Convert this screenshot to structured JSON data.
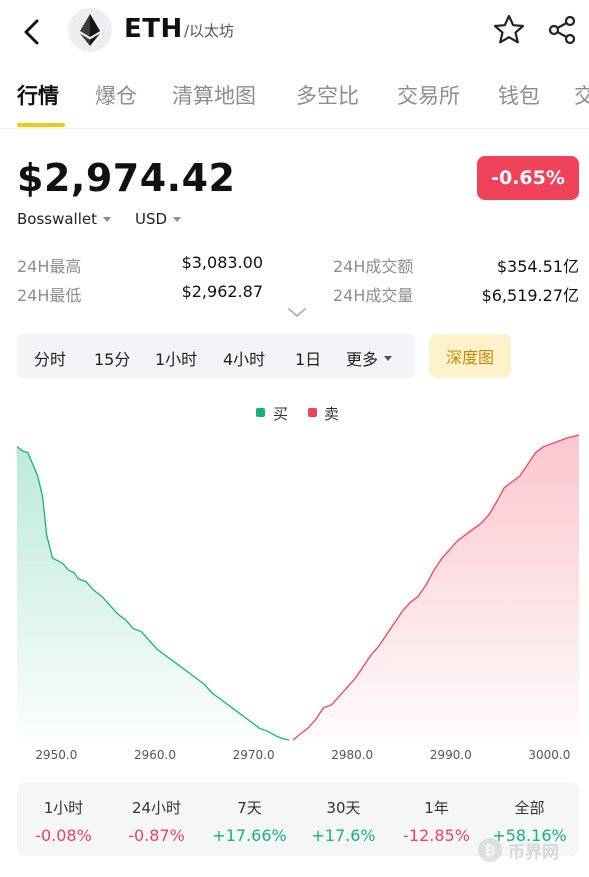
{
  "header": {
    "symbol": "ETH",
    "name": "/以太坊",
    "back_icon": "back-arrow-icon",
    "logo_icon": "ethereum-logo-icon",
    "star_icon": "star-icon",
    "share_icon": "share-icon"
  },
  "tabs": [
    {
      "label": "行情",
      "active": true
    },
    {
      "label": "爆仓"
    },
    {
      "label": "清算地图"
    },
    {
      "label": "多空比"
    },
    {
      "label": "交易所"
    },
    {
      "label": "钱包"
    },
    {
      "label": "交"
    }
  ],
  "price": {
    "value": "$2,974.42",
    "change": "-0.65%",
    "exchange": "Bosswallet",
    "currency": "USD"
  },
  "stats": {
    "high_label": "24H最高",
    "high_value": "$3,083.00",
    "low_label": "24H最低",
    "low_value": "$2,962.87",
    "turnover_label": "24H成交额",
    "turnover_value": "$354.51亿",
    "volume_label": "24H成交量",
    "volume_value": "$6,519.27亿"
  },
  "intervals": [
    "分时",
    "15分",
    "1小时",
    "4小时",
    "1日",
    "更多"
  ],
  "depth_button": "深度图",
  "legend": {
    "buy": "买",
    "sell": "卖"
  },
  "colors": {
    "buy": "#16b37a",
    "sell": "#f0425a",
    "accent": "#f5c518"
  },
  "chart_data": {
    "type": "area",
    "x_ticks": [
      "2950.0",
      "2960.0",
      "2970.0",
      "2980.0",
      "2990.0",
      "3000.0"
    ],
    "xlim": [
      2946,
      3003
    ],
    "series": [
      {
        "name": "买",
        "x": [
          2946.0,
          2946.6,
          2947.1,
          2947.6,
          2948.1,
          2948.6,
          2949.0,
          2949.6,
          2950.2,
          2950.7,
          2951.2,
          2951.8,
          2952.2,
          2953.0,
          2953.8,
          2954.6,
          2955.4,
          2956.2,
          2957.0,
          2957.8,
          2958.6,
          2959.4,
          2960.2,
          2961.0,
          2961.8,
          2962.6,
          2963.4,
          2964.2,
          2965.0,
          2965.8,
          2966.6,
          2967.4,
          2968.2,
          2969.0,
          2969.8,
          2970.6,
          2971.4,
          2972.2,
          2972.9,
          2973.6
        ],
        "y": [
          100,
          98.5,
          98.0,
          94,
          90,
          83,
          70,
          62,
          61,
          60,
          58,
          57,
          55,
          54,
          51,
          49,
          46,
          43,
          41,
          38,
          37,
          34,
          31,
          29,
          27,
          25,
          23,
          21,
          19,
          16,
          14,
          12,
          10,
          8,
          6,
          4,
          3,
          1.5,
          0.5,
          0
        ]
      },
      {
        "name": "卖",
        "x": [
          2974.0,
          2974.7,
          2975.5,
          2976.3,
          2977.1,
          2977.9,
          2978.7,
          2979.5,
          2980.3,
          2981.1,
          2981.9,
          2982.7,
          2983.5,
          2984.3,
          2985.1,
          2985.9,
          2986.7,
          2987.5,
          2988.3,
          2989.1,
          2989.9,
          2990.7,
          2991.5,
          2992.3,
          2993.1,
          2993.9,
          2994.6,
          2995.4,
          2996.2,
          2997.0,
          2997.8,
          2998.6,
          2999.4,
          3000.2,
          3001.0,
          3001.8,
          3003.0
        ],
        "y": [
          0,
          2,
          4,
          7,
          11,
          12,
          15,
          18,
          21,
          25,
          29,
          32,
          36,
          40,
          44,
          47,
          49,
          53,
          58,
          62,
          65,
          68,
          70,
          72,
          74,
          77,
          81,
          86,
          88,
          90,
          94,
          98,
          100,
          101,
          102,
          103,
          104
        ]
      }
    ]
  },
  "performance": [
    {
      "label": "1小时",
      "value": "-0.08%",
      "trend": "neg"
    },
    {
      "label": "24小时",
      "value": "-0.87%",
      "trend": "neg"
    },
    {
      "label": "7天",
      "value": "+17.66%",
      "trend": "pos"
    },
    {
      "label": "30天",
      "value": "+17.6%",
      "trend": "pos"
    },
    {
      "label": "1年",
      "value": "-12.85%",
      "trend": "neg"
    },
    {
      "label": "全部",
      "value": "+58.16%",
      "trend": "pos"
    }
  ],
  "watermark": {
    "icon": "bitcoin-icon",
    "text": "币界网"
  }
}
